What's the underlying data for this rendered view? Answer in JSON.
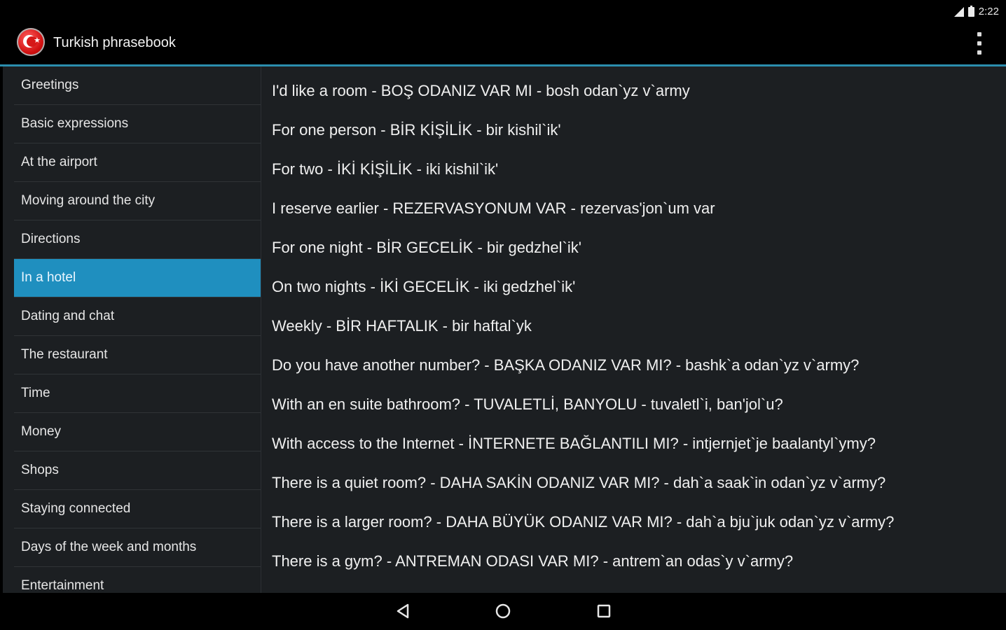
{
  "status_bar": {
    "time": "2:22",
    "signal_icon": "signal-icon",
    "battery_icon": "battery-icon"
  },
  "action_bar": {
    "title": "Turkish phrasebook",
    "app_icon": "turkish-flag-icon",
    "overflow_icon": "more-vert-icon"
  },
  "colors": {
    "accent": "#33a7cc",
    "selected": "#1f8fbf",
    "background": "#1c1f22"
  },
  "categories": [
    {
      "label": "Greetings",
      "selected": false
    },
    {
      "label": "Basic expressions",
      "selected": false
    },
    {
      "label": "At the airport",
      "selected": false
    },
    {
      "label": "Moving around the city",
      "selected": false
    },
    {
      "label": "Directions",
      "selected": false
    },
    {
      "label": "In a hotel",
      "selected": true
    },
    {
      "label": "Dating and chat",
      "selected": false
    },
    {
      "label": "The restaurant",
      "selected": false
    },
    {
      "label": "Time",
      "selected": false
    },
    {
      "label": "Money",
      "selected": false
    },
    {
      "label": "Shops",
      "selected": false
    },
    {
      "label": "Staying connected",
      "selected": false
    },
    {
      "label": "Days of the week and months",
      "selected": false
    },
    {
      "label": "Entertainment",
      "selected": false
    }
  ],
  "phrases": [
    "I'd like a room - BOŞ ODANIZ VAR MI - bosh odan`yz v`army",
    "For one person - BİR KİŞİLİK - bir kishil`ik'",
    "For two - İKİ KİŞİLİK - iki kishil`ik'",
    "I reserve earlier - REZERVASYONUM VAR - rezervas'jon`um var",
    "For one night - BİR GECELİK - bir gedzhel`ik'",
    "On two nights - İKİ GECELİK - iki gedzhel`ik'",
    "Weekly - BİR HAFTALIK - bir haftal`yk",
    "Do you have another number? - BAŞKA ODANIZ VAR MI? - bashk`a odan`yz v`army?",
    "With an en suite bathroom? - TUVALETLİ, BANYOLU - tuvaletl`i, ban'jol`u?",
    "With access to the Internet - İNTERNETE BAĞLANTILI MI? - intjernjet`je baalantyl`ymy?",
    "There is a quiet room? - DAHA SAKİN ODANIZ VAR MI? - dah`a saak`in odan`yz v`army?",
    "There is a larger room? - DAHA BÜYÜK ODANIZ VAR MI? - dah`a bju`juk odan`yz v`army?",
    "There is a gym? - ANTREMAN ODASI VAR MI? - antrem`an odas`y v`army?"
  ],
  "nav_bar": {
    "back_icon": "back-icon",
    "home_icon": "home-icon",
    "recents_icon": "recents-icon"
  }
}
